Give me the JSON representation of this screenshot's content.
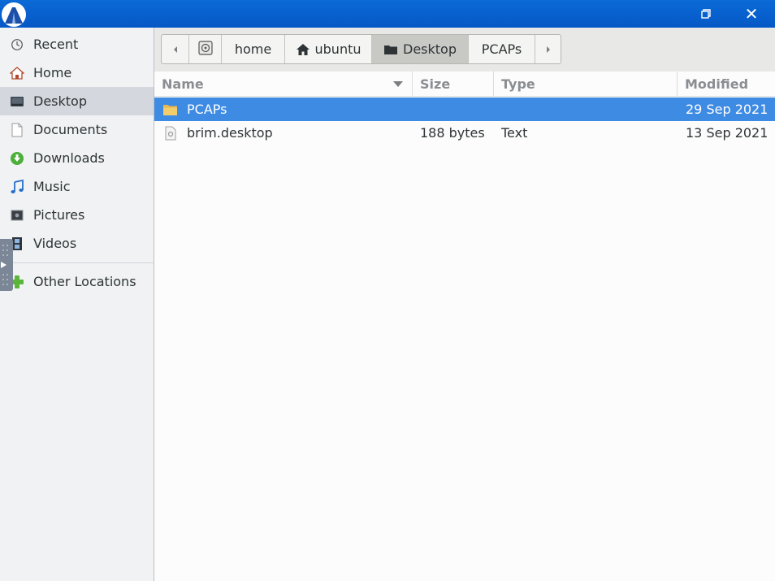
{
  "window": {
    "restore_icon": "restore-icon",
    "close_glyph": "✕"
  },
  "sidebar": {
    "items": [
      {
        "label": "Recent",
        "icon": "clock-icon"
      },
      {
        "label": "Home",
        "icon": "home-icon"
      },
      {
        "label": "Desktop",
        "icon": "desktop-icon",
        "selected": true
      },
      {
        "label": "Documents",
        "icon": "document-icon"
      },
      {
        "label": "Downloads",
        "icon": "download-icon"
      },
      {
        "label": "Music",
        "icon": "music-note-icon"
      },
      {
        "label": "Pictures",
        "icon": "picture-icon"
      },
      {
        "label": "Videos",
        "icon": "film-icon"
      },
      {
        "label": "Other Locations",
        "icon": "plus-icon"
      }
    ]
  },
  "pathbar": {
    "crumbs": [
      {
        "label": "",
        "icon": "left-arrow-icon"
      },
      {
        "label": "",
        "icon": "drive-icon"
      },
      {
        "label": "home"
      },
      {
        "label": "ubuntu",
        "icon": "home-icon"
      },
      {
        "label": "Desktop",
        "icon": "folder-icon",
        "active": true
      },
      {
        "label": "PCAPs"
      },
      {
        "label": "",
        "icon": "right-arrow-icon"
      }
    ]
  },
  "columns": {
    "name": "Name",
    "size": "Size",
    "type": "Type",
    "modified": "Modified"
  },
  "files": [
    {
      "name": "PCAPs",
      "size": "",
      "type": "",
      "modified": "29 Sep 2021",
      "icon": "folder-icon",
      "selected": true
    },
    {
      "name": "brim.desktop",
      "size": "188 bytes",
      "type": "Text",
      "modified": "13 Sep 2021",
      "icon": "file-icon",
      "selected": false
    }
  ],
  "colors": {
    "titlebar": "#0558c6",
    "selection": "#3e8be4",
    "folder": "#f0c55c"
  }
}
